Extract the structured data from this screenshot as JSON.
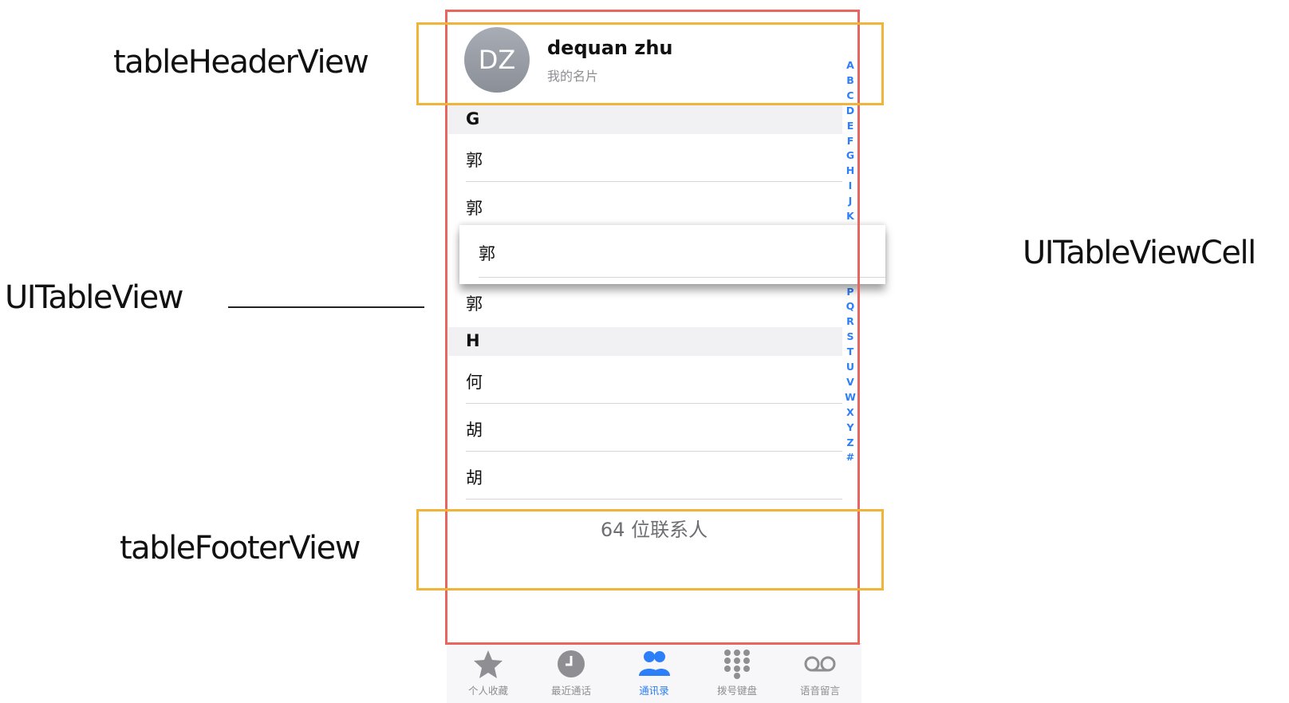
{
  "annotations": {
    "header": "tableHeaderView",
    "table": "UITableView",
    "cell": "UITableViewCell",
    "footer": "tableFooterView"
  },
  "header": {
    "initials": "DZ",
    "name": "dequan zhu",
    "subtitle": "我的名片"
  },
  "sections": [
    {
      "letter": "G",
      "rows": [
        "郭",
        "郭",
        "郭"
      ]
    },
    {
      "letter": "H",
      "rows": [
        "何",
        "胡",
        "胡"
      ]
    }
  ],
  "floating_cell": {
    "text": "郭"
  },
  "index": [
    "A",
    "B",
    "C",
    "D",
    "E",
    "F",
    "G",
    "H",
    "I",
    "J",
    "K",
    "P",
    "Q",
    "R",
    "S",
    "T",
    "U",
    "V",
    "W",
    "X",
    "Y",
    "Z",
    "#"
  ],
  "footer": {
    "count_text": "64 位联系人"
  },
  "tabs": [
    {
      "label": "个人收藏",
      "icon": "star-icon",
      "active": false
    },
    {
      "label": "最近通话",
      "icon": "clock-icon",
      "active": false
    },
    {
      "label": "通讯录",
      "icon": "contacts-icon",
      "active": true
    },
    {
      "label": "拨号键盘",
      "icon": "keypad-icon",
      "active": false
    },
    {
      "label": "语音留言",
      "icon": "voicemail-icon",
      "active": false
    }
  ],
  "colors": {
    "table_outline": "#e8665e",
    "header_footer_outline": "#f2b339",
    "accent": "#2d7ff9",
    "inactive_tab": "#8e8e93"
  }
}
